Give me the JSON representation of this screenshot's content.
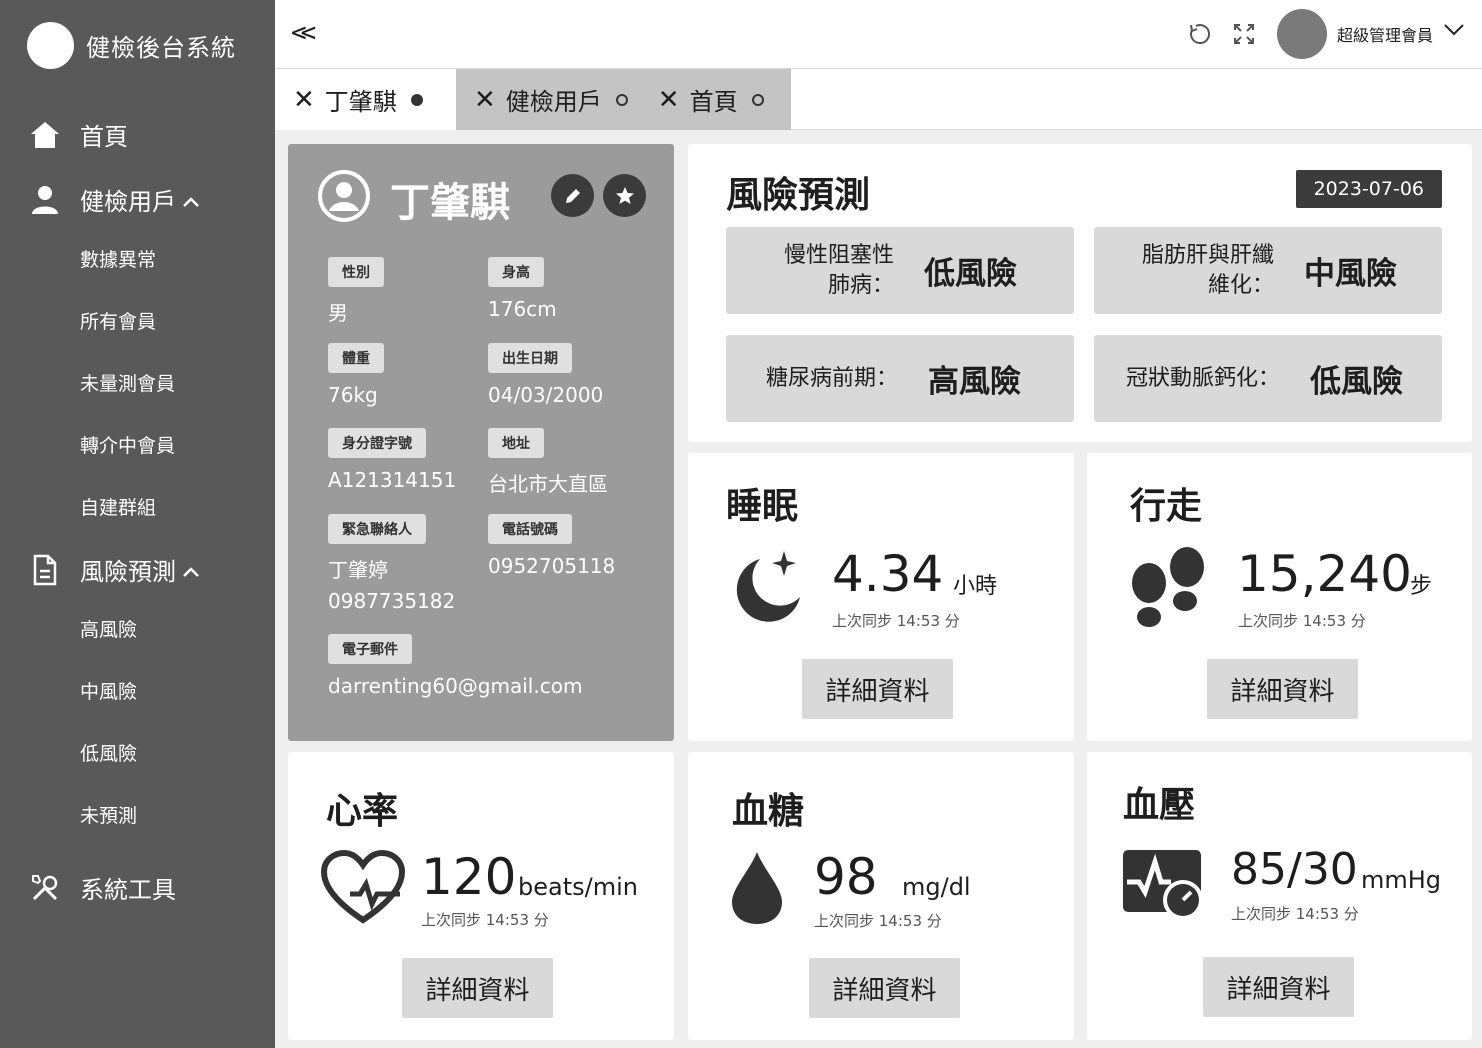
{
  "app": {
    "title": "健檢後台系統"
  },
  "sidebar": {
    "home": "首頁",
    "users": {
      "label": "健檢用戶",
      "children": [
        "數據異常",
        "所有會員",
        "未量測會員",
        "轉介中會員",
        "自建群組"
      ]
    },
    "risk": {
      "label": "風險預測",
      "children": [
        "高風險",
        "中風險",
        "低風險",
        "未預測"
      ]
    },
    "tools": "系統工具"
  },
  "topbar": {
    "collapse": "<<",
    "admin": "超級管理會員"
  },
  "tabs": [
    {
      "label": "丁肇騏",
      "active": true
    },
    {
      "label": "健檢用戶",
      "active": false
    },
    {
      "label": "首頁",
      "active": false
    }
  ],
  "profile": {
    "name": "丁肇騏",
    "gender_label": "性別",
    "gender": "男",
    "height_label": "身高",
    "height": "176cm",
    "weight_label": "體重",
    "weight": "76kg",
    "dob_label": "出生日期",
    "dob": "04/03/2000",
    "id_label": "身分證字號",
    "id": "A121314151",
    "address_label": "地址",
    "address": "台北市大直區",
    "emergency_label": "緊急聯絡人",
    "emergency_name": "丁肇婷",
    "emergency_phone": "0987735182",
    "phone_label": "電話號碼",
    "phone": "0952705118",
    "email_label": "電子郵件",
    "email": "darrenting60@gmail.com"
  },
  "risk": {
    "title": "風險預測",
    "date": "2023-07-06",
    "items": [
      {
        "label_line1": "慢性阻塞性",
        "label_line2": "肺病：",
        "level": "低風險"
      },
      {
        "label_line1": "脂肪肝與肝纖",
        "label_line2": "維化：",
        "level": "中風險"
      },
      {
        "label_line1": "糖尿病前期：",
        "label_line2": "",
        "level": "高風險"
      },
      {
        "label_line1": "冠狀動脈鈣化：",
        "label_line2": "",
        "level": "低風險"
      }
    ]
  },
  "sleep": {
    "title": "睡眠",
    "value": "4.34",
    "unit": "小時",
    "sync": "上次同步 14:53 分",
    "button": "詳細資料"
  },
  "walk": {
    "title": "行走",
    "value": "15,240",
    "unit": "步",
    "sync": "上次同步 14:53 分",
    "button": "詳細資料"
  },
  "heart": {
    "title": "心率",
    "value": "120",
    "unit": "beats/min",
    "sync": "上次同步 14:53 分",
    "button": "詳細資料"
  },
  "sugar": {
    "title": "血糖",
    "value": "98",
    "unit": "mg/dl",
    "sync": "上次同步 14:53 分",
    "button": "詳細資料"
  },
  "pressure": {
    "title": "血壓",
    "value": "85/30",
    "unit": "mmHg",
    "sync": "上次同步 14:53 分",
    "button": "詳細資料"
  }
}
